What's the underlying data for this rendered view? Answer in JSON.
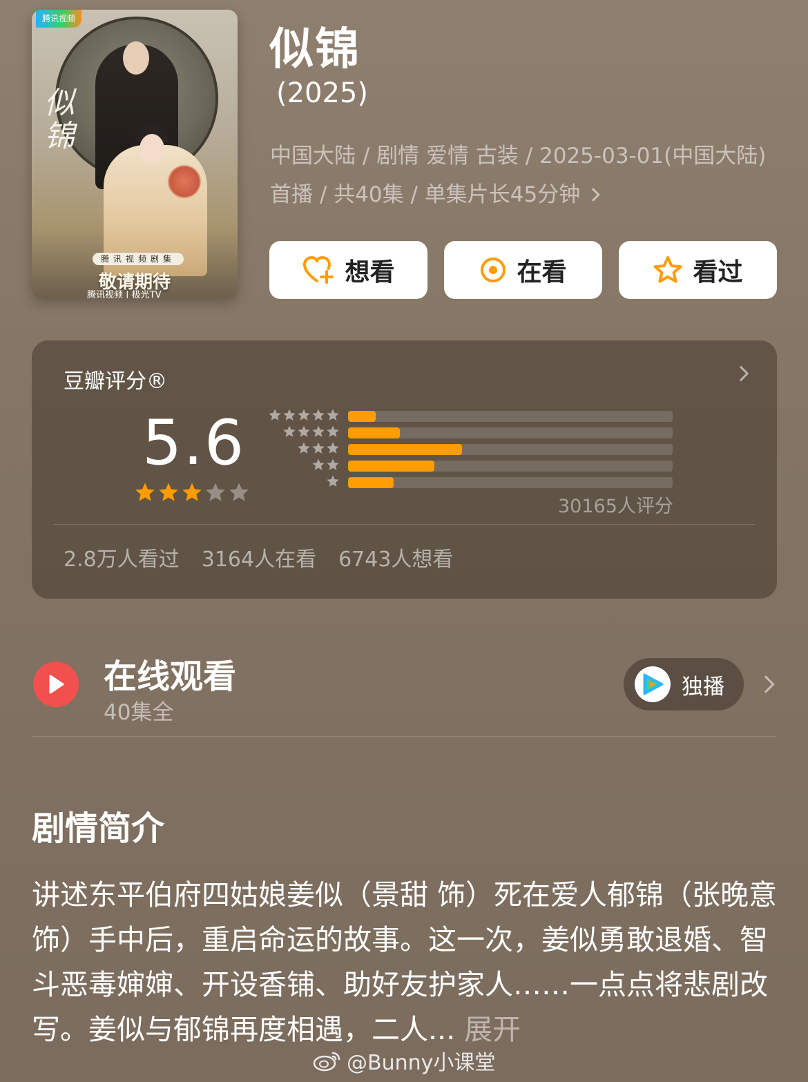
{
  "poster": {
    "platform_badge": "腾讯视频",
    "calligraphy": "似锦",
    "banner": "腾讯视频剧集",
    "coming_soon": "敬请期待",
    "footer": "腾讯视频 | 极光TV"
  },
  "header": {
    "title": "似锦",
    "year": "(2025)",
    "meta": "中国大陆 / 剧情 爱情 古装 / 2025-03-01(中国大陆) 首播 / 共40集 / 单集片长45分钟"
  },
  "actions": [
    {
      "label": "想看",
      "icon": "heart-plus-icon"
    },
    {
      "label": "在看",
      "icon": "target-icon"
    },
    {
      "label": "看过",
      "icon": "star-outline-icon"
    }
  ],
  "rating": {
    "label": "豆瓣评分®",
    "score": "5.6",
    "stars_filled": 3,
    "stars_total": 5,
    "distribution": [
      {
        "stars": 5,
        "fraction": 0.085
      },
      {
        "stars": 4,
        "fraction": 0.16
      },
      {
        "stars": 3,
        "fraction": 0.35
      },
      {
        "stars": 2,
        "fraction": 0.265
      },
      {
        "stars": 1,
        "fraction": 0.14
      }
    ],
    "count": "30165人评分",
    "stats": [
      "2.8万人看过",
      "3164人在看",
      "6743人想看"
    ]
  },
  "online": {
    "title": "在线观看",
    "subtitle": "40集全",
    "exclusive_label": "独播"
  },
  "synopsis": {
    "title": "剧情简介",
    "text": "讲述东平伯府四姑娘姜似（景甜 饰）死在爱人郁锦（张晚意 饰）手中后，重启命运的故事。这一次，姜似勇敢退婚、智斗恶毒婶婶、开设香铺、助好友护家人……一点点将悲剧改写。姜似与郁锦再度相遇，二人...",
    "expand": "展开"
  },
  "watermark": "@Bunny小课堂",
  "colors": {
    "accent_orange": "#ff9c00",
    "play_red": "#f2504f",
    "star_orange": "#ff9c00"
  }
}
